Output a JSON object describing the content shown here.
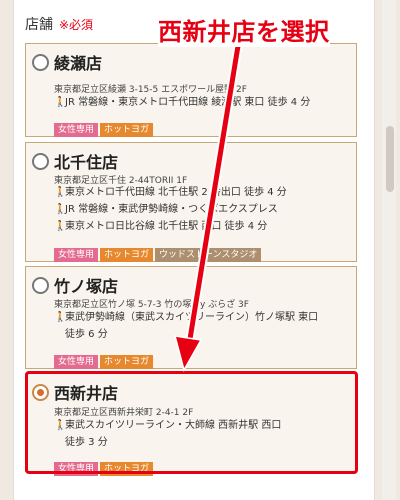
{
  "field": {
    "label": "店舗",
    "required": "※必須"
  },
  "annotation": {
    "text": "西新井店を選択"
  },
  "stores": [
    {
      "name": "綾瀬店",
      "address": "東京都足立区綾瀬 3-15-5 エスポワール屋野 2F",
      "access": [
        "JR 常磐線・東京メトロ千代田線 綾瀬駅 東口 徒歩 4 分"
      ],
      "tags": [
        "女性専用",
        "ホットヨガ"
      ],
      "checked": false
    },
    {
      "name": "北千住店",
      "address": "東京都足立区千住 2-44TORII 1F",
      "access": [
        "東京メトロ千代田線 北千住駅 2 番出口 徒歩 4 分",
        "JR 常磐線・東武伊勢崎線・つくばエクスプレス",
        "東京メトロ日比谷線 北千住駅 西口 徒歩 4 分"
      ],
      "tags": [
        "女性専用",
        "ホットヨガ",
        "ウッドストーンスタジオ"
      ],
      "checked": false
    },
    {
      "name": "竹ノ塚店",
      "address": "東京都足立区竹ノ塚 5-7-3 竹の塚 by ぶらざ 3F",
      "access": [
        "東武伊勢崎線（東武スカイツリーライン）竹ノ塚駅 東口",
        "徒歩 6 分"
      ],
      "tags": [
        "女性専用",
        "ホットヨガ"
      ],
      "checked": false
    },
    {
      "name": "西新井店",
      "address": "東京都足立区西新井栄町 2-4-1 2F",
      "access": [
        "東武スカイツリーライン・大師線 西新井駅 西口",
        "徒歩 3 分"
      ],
      "tags": [
        "女性専用",
        "ホットヨガ"
      ],
      "checked": true
    }
  ]
}
